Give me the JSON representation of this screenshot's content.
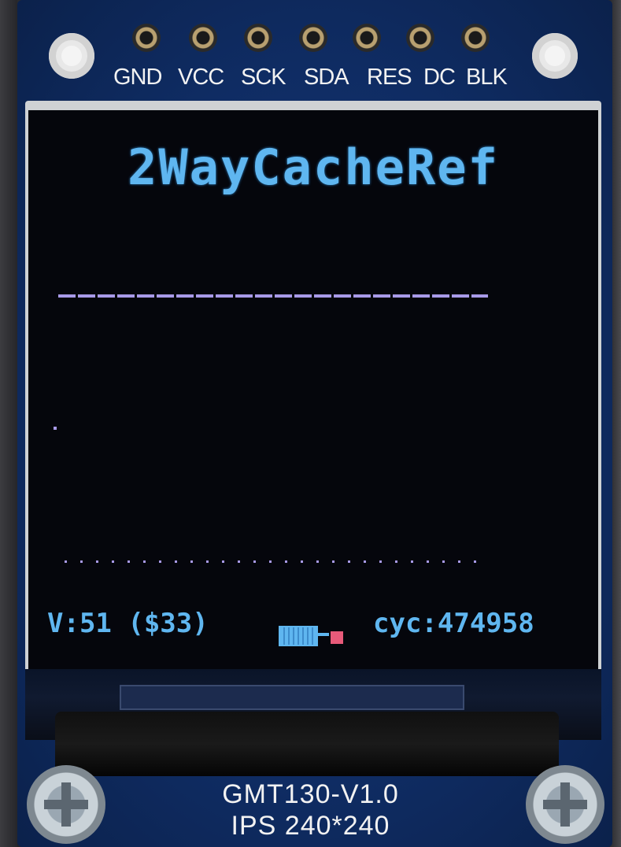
{
  "board": {
    "pin_labels": [
      "GND",
      "VCC",
      "SCK",
      "SDA",
      "RES",
      "DC",
      "BLK"
    ],
    "model_label": "GMT130-V1.0",
    "panel_label": "IPS 240*240"
  },
  "screen": {
    "title": "2WayCacheRef",
    "status_left": "V:51 ($33)",
    "status_right": "cyc:474958",
    "colors": {
      "title": "#5fb6f0",
      "lines": "#a89ae8",
      "battery_alert": "#e85a7a",
      "background": "#05060c"
    }
  }
}
